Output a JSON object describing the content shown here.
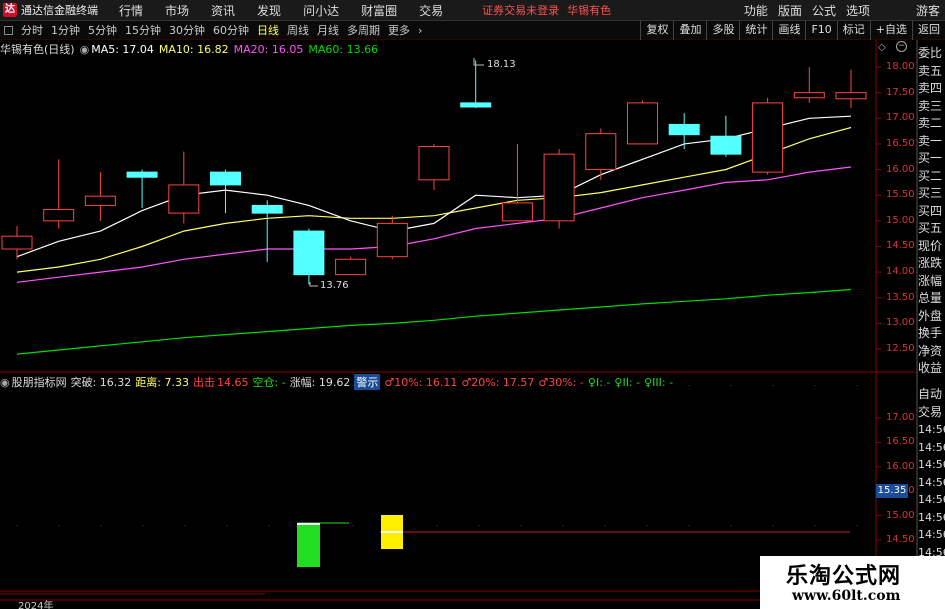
{
  "menu": {
    "app_name": "通达信金融终端",
    "items": [
      "行情",
      "市场",
      "资讯",
      "发现",
      "问小达",
      "财富圈",
      "交易"
    ],
    "notice": "证券交易未登录",
    "stock": "华锡有色",
    "right_items": [
      "功能",
      "版面",
      "公式",
      "选项"
    ],
    "guest": "游客"
  },
  "periods": {
    "items": [
      "分时",
      "1分钟",
      "5分钟",
      "15分钟",
      "30分钟",
      "60分钟",
      "日线",
      "周线",
      "月线",
      "多周期",
      "更多"
    ],
    "active": "日线",
    "tools": [
      "复权",
      "叠加",
      "多股",
      "统计",
      "画线",
      "F10",
      "标记",
      "+自选",
      "返回"
    ]
  },
  "main_header": {
    "title": "华锡有色(日线)",
    "ma5": "MA5: 17.04",
    "ma10": "MA10: 16.82",
    "ma20": "MA20: 16.05",
    "ma60": "MA60: 13.66"
  },
  "indicator_header": {
    "name": "股朋指标网",
    "tupo": "突破: 16.32",
    "juli": "距离: 7.33",
    "chuji": "出击",
    "chuji_val": "14.65",
    "kongcang": "空仓: -",
    "zhangfu": "涨幅: 19.62",
    "jingshi": "警示",
    "g10": "♂10%: 16.11",
    "g20": "♂20%: 17.57",
    "g30": "♂30%: -",
    "f1": "♀I: -",
    "f2": "♀II: -",
    "f3": "♀III: -"
  },
  "price_axis": [
    "18.00",
    "17.50",
    "17.00",
    "16.50",
    "16.00",
    "15.50",
    "15.00",
    "14.50",
    "14.00",
    "13.50",
    "13.00",
    "12.50"
  ],
  "ind_axis": [
    "17.00",
    "16.50",
    "16.00",
    "15.50",
    "15.00",
    "14.50"
  ],
  "ind_marker": "15.35",
  "annotations": {
    "high": "18.13",
    "low": "13.76"
  },
  "right_panel": [
    "委比",
    "卖五",
    "卖四",
    "卖三",
    "卖二",
    "卖一",
    "买一",
    "买二",
    "买三",
    "买四",
    "买五",
    "现价",
    "涨跌",
    "涨幅",
    "总量",
    "外盘",
    "换手",
    "净资",
    "收益"
  ],
  "right_panel2": [
    "自动",
    "交易",
    "14:56",
    "14:56",
    "14:56",
    "14:56",
    "14:56",
    "14:56",
    "14:56",
    "14:56",
    "14:56",
    "14:56"
  ],
  "year_label": "2024年",
  "watermark": {
    "line1": "乐淘公式网",
    "line2": "www.60lt.com"
  },
  "colors": {
    "up": "#ff4444",
    "down": "#54ffff",
    "ma5": "#ffffff",
    "ma10": "#ffff66",
    "ma20": "#ff55ff",
    "ma60": "#00dd00"
  },
  "chart_data": {
    "type": "candlestick",
    "ylim": [
      12.2,
      18.4
    ],
    "candles": [
      {
        "o": 14.45,
        "h": 14.9,
        "l": 14.25,
        "c": 14.7
      },
      {
        "o": 15.0,
        "h": 16.2,
        "l": 14.85,
        "c": 15.22
      },
      {
        "o": 15.3,
        "h": 15.95,
        "l": 15.0,
        "c": 15.48
      },
      {
        "o": 15.95,
        "h": 16.0,
        "l": 15.25,
        "c": 15.85
      },
      {
        "o": 15.15,
        "h": 16.35,
        "l": 14.95,
        "c": 15.7
      },
      {
        "o": 15.95,
        "h": 16.0,
        "l": 15.15,
        "c": 15.7
      },
      {
        "o": 15.3,
        "h": 15.4,
        "l": 14.2,
        "c": 15.15
      },
      {
        "o": 14.8,
        "h": 14.85,
        "l": 13.76,
        "c": 13.95
      },
      {
        "o": 13.95,
        "h": 14.3,
        "l": 13.95,
        "c": 14.25
      },
      {
        "o": 14.3,
        "h": 15.1,
        "l": 14.25,
        "c": 14.95
      },
      {
        "o": 15.8,
        "h": 16.5,
        "l": 15.6,
        "c": 16.45
      },
      {
        "o": 17.3,
        "h": 18.13,
        "l": 17.2,
        "c": 17.22
      },
      {
        "o": 15.0,
        "h": 16.5,
        "l": 15.0,
        "c": 15.35
      },
      {
        "o": 15.0,
        "h": 16.4,
        "l": 14.85,
        "c": 16.3
      },
      {
        "o": 16.0,
        "h": 16.8,
        "l": 15.8,
        "c": 16.7
      },
      {
        "o": 16.5,
        "h": 17.35,
        "l": 16.5,
        "c": 17.3
      },
      {
        "o": 16.88,
        "h": 17.1,
        "l": 16.4,
        "c": 16.68
      },
      {
        "o": 16.65,
        "h": 17.05,
        "l": 16.25,
        "c": 16.3
      },
      {
        "o": 15.95,
        "h": 17.4,
        "l": 15.9,
        "c": 17.3
      },
      {
        "o": 17.4,
        "h": 18.0,
        "l": 17.3,
        "c": 17.5
      },
      {
        "o": 17.38,
        "h": 17.95,
        "l": 17.2,
        "c": 17.5
      }
    ],
    "ma5": [
      14.3,
      14.6,
      14.8,
      15.2,
      15.5,
      15.6,
      15.5,
      15.3,
      15.0,
      14.8,
      14.95,
      15.5,
      15.45,
      15.5,
      15.9,
      16.2,
      16.5,
      16.6,
      16.8,
      17.0,
      17.04
    ],
    "ma10": [
      14.0,
      14.1,
      14.25,
      14.5,
      14.8,
      14.95,
      15.05,
      15.1,
      15.05,
      15.05,
      15.1,
      15.25,
      15.4,
      15.45,
      15.55,
      15.7,
      15.85,
      16.0,
      16.3,
      16.6,
      16.82
    ],
    "ma20": [
      13.8,
      13.9,
      14.0,
      14.1,
      14.25,
      14.35,
      14.45,
      14.45,
      14.45,
      14.5,
      14.65,
      14.85,
      14.95,
      15.05,
      15.25,
      15.45,
      15.6,
      15.75,
      15.8,
      15.95,
      16.05
    ],
    "ma60": [
      12.4,
      12.48,
      12.56,
      12.64,
      12.72,
      12.78,
      12.84,
      12.9,
      12.96,
      13.0,
      13.06,
      13.14,
      13.2,
      13.26,
      13.32,
      13.38,
      13.43,
      13.48,
      13.55,
      13.6,
      13.66
    ]
  }
}
